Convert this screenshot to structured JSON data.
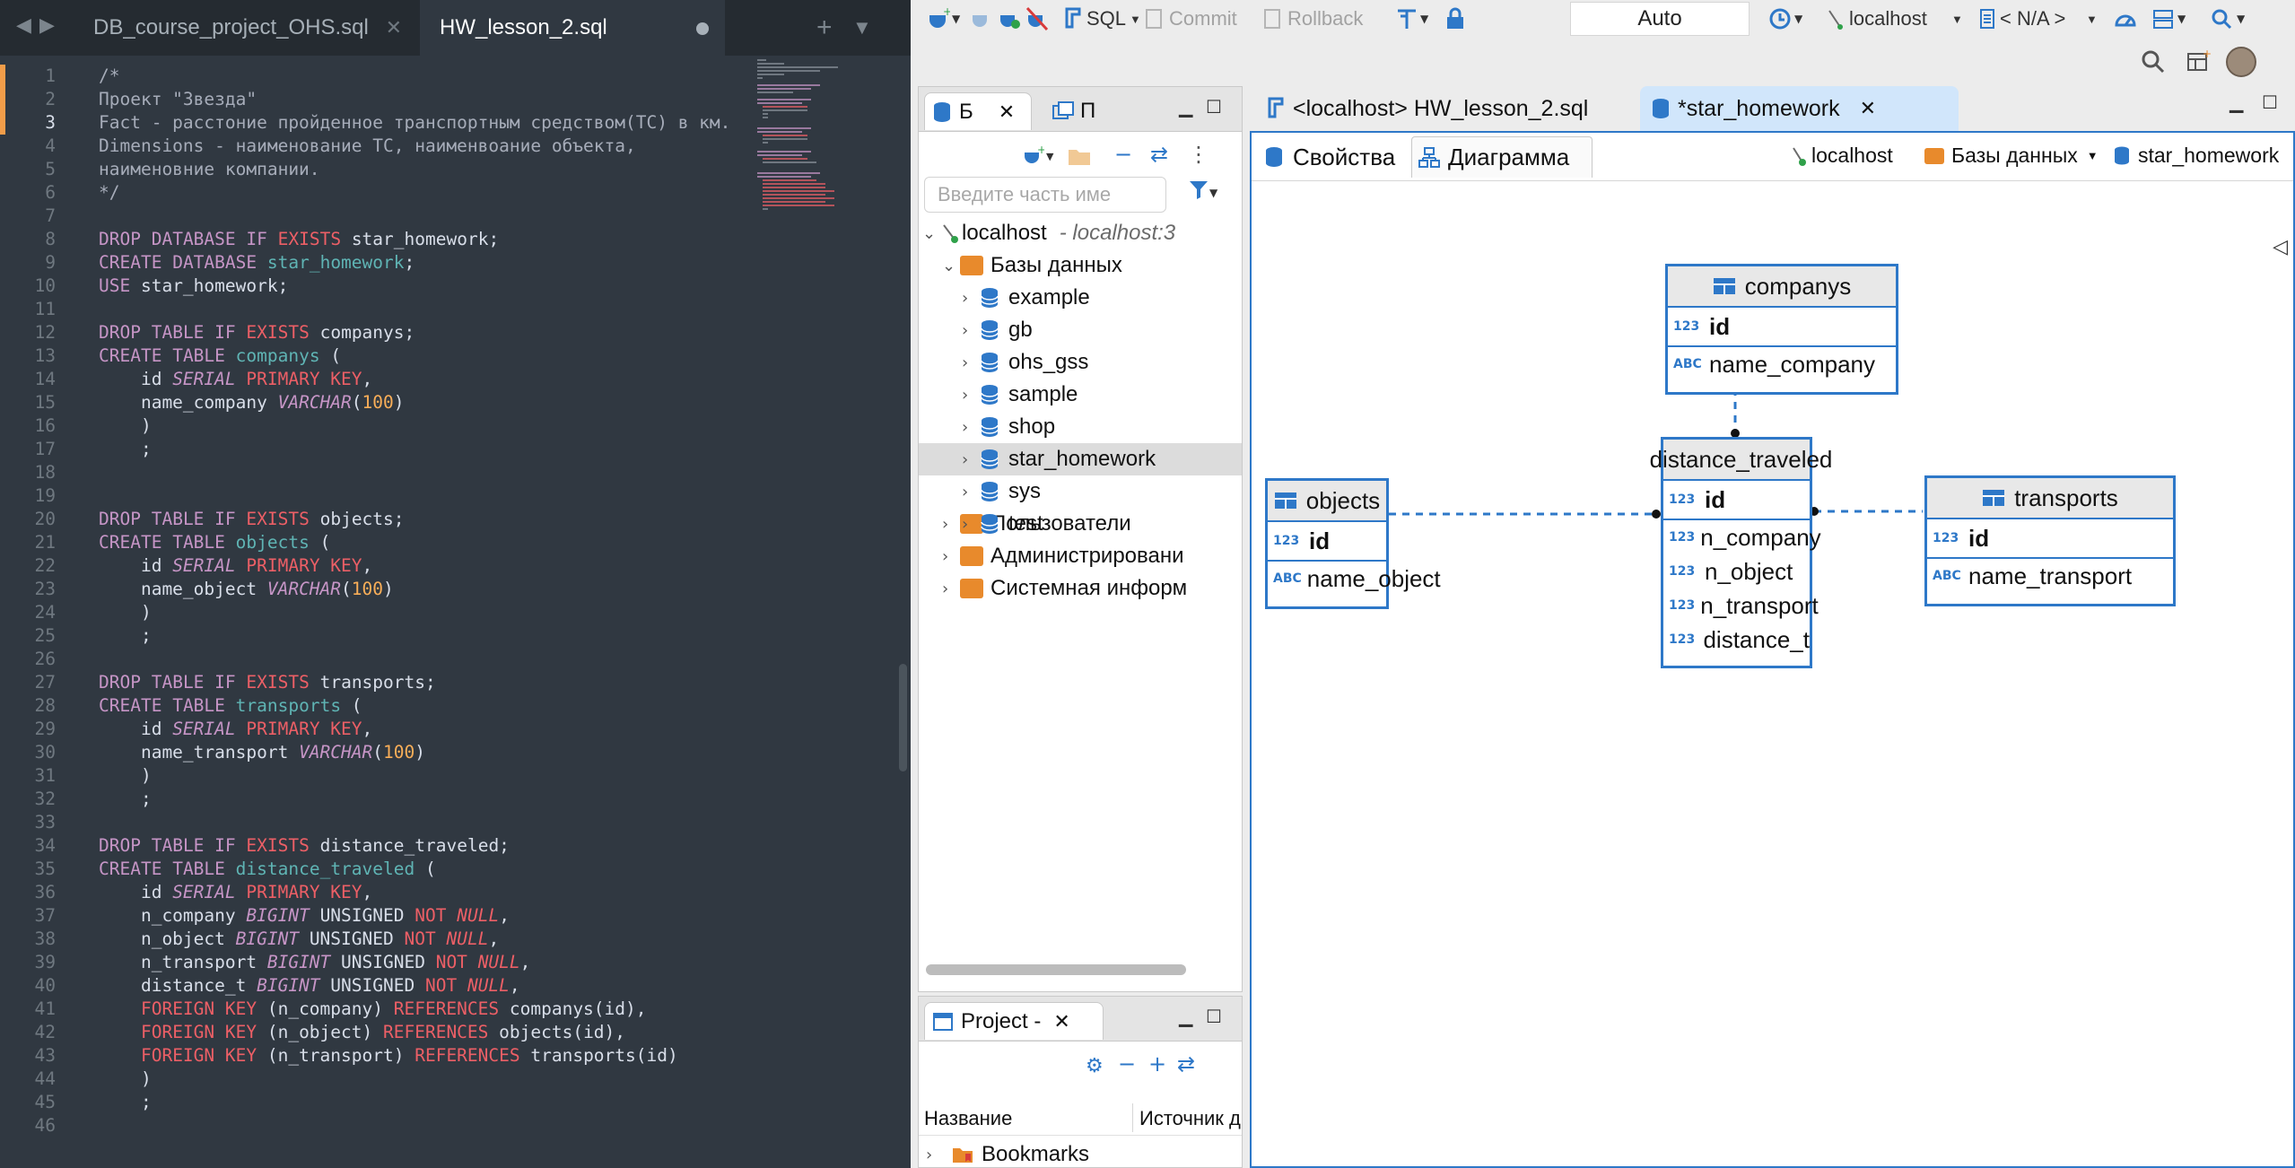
{
  "editor": {
    "tabs": [
      {
        "label": "DB_course_project_OHS.sql"
      },
      {
        "label": "HW_lesson_2.sql"
      }
    ],
    "lines": [
      [
        [
          "c",
          "/*"
        ]
      ],
      [
        [
          "c",
          "Проект \"Звезда\""
        ]
      ],
      [
        [
          "c",
          "Fact - расстоние пройденное транспортным средством(ТС) в км."
        ]
      ],
      [
        [
          "c",
          "Dimensions - наименование ТС, наименвоание объекта,"
        ]
      ],
      [
        [
          "c",
          "наименовние компании."
        ]
      ],
      [
        [
          "c",
          "*/"
        ]
      ],
      [],
      [
        [
          "k",
          "DROP"
        ],
        [
          "p",
          " "
        ],
        [
          "k",
          "DATABASE"
        ],
        [
          "p",
          " "
        ],
        [
          "k",
          "IF"
        ],
        [
          "p",
          " "
        ],
        [
          "r",
          "EXISTS"
        ],
        [
          "p",
          " star_homework;"
        ]
      ],
      [
        [
          "k",
          "CREATE"
        ],
        [
          "p",
          " "
        ],
        [
          "k",
          "DATABASE"
        ],
        [
          "p",
          " "
        ],
        [
          "i",
          "star_homework"
        ],
        [
          "p",
          ";"
        ]
      ],
      [
        [
          "k",
          "USE"
        ],
        [
          "p",
          " star_homework;"
        ]
      ],
      [],
      [
        [
          "k",
          "DROP"
        ],
        [
          "p",
          " "
        ],
        [
          "k",
          "TABLE"
        ],
        [
          "p",
          " "
        ],
        [
          "k",
          "IF"
        ],
        [
          "p",
          " "
        ],
        [
          "r",
          "EXISTS"
        ],
        [
          "p",
          " companys;"
        ]
      ],
      [
        [
          "k",
          "CREATE"
        ],
        [
          "p",
          " "
        ],
        [
          "k",
          "TABLE"
        ],
        [
          "p",
          " "
        ],
        [
          "i",
          "companys"
        ],
        [
          "p",
          " ("
        ]
      ],
      [
        [
          "p",
          "    id "
        ],
        [
          "t",
          "SERIAL"
        ],
        [
          "p",
          " "
        ],
        [
          "r",
          "PRIMARY KEY"
        ],
        [
          "p",
          ","
        ]
      ],
      [
        [
          "p",
          "    name_company "
        ],
        [
          "t",
          "VARCHAR"
        ],
        [
          "p",
          "("
        ],
        [
          "n",
          "100"
        ],
        [
          "p",
          ")"
        ]
      ],
      [
        [
          "p",
          "    )"
        ]
      ],
      [
        [
          "p",
          "    ;"
        ]
      ],
      [],
      [],
      [
        [
          "k",
          "DROP"
        ],
        [
          "p",
          " "
        ],
        [
          "k",
          "TABLE"
        ],
        [
          "p",
          " "
        ],
        [
          "k",
          "IF"
        ],
        [
          "p",
          " "
        ],
        [
          "r",
          "EXISTS"
        ],
        [
          "p",
          " objects;"
        ]
      ],
      [
        [
          "k",
          "CREATE"
        ],
        [
          "p",
          " "
        ],
        [
          "k",
          "TABLE"
        ],
        [
          "p",
          " "
        ],
        [
          "i",
          "objects"
        ],
        [
          "p",
          " ("
        ]
      ],
      [
        [
          "p",
          "    id "
        ],
        [
          "t",
          "SERIAL"
        ],
        [
          "p",
          " "
        ],
        [
          "r",
          "PRIMARY KEY"
        ],
        [
          "p",
          ","
        ]
      ],
      [
        [
          "p",
          "    name_object "
        ],
        [
          "t",
          "VARCHAR"
        ],
        [
          "p",
          "("
        ],
        [
          "n",
          "100"
        ],
        [
          "p",
          ")"
        ]
      ],
      [
        [
          "p",
          "    )"
        ]
      ],
      [
        [
          "p",
          "    ;"
        ]
      ],
      [],
      [
        [
          "k",
          "DROP"
        ],
        [
          "p",
          " "
        ],
        [
          "k",
          "TABLE"
        ],
        [
          "p",
          " "
        ],
        [
          "k",
          "IF"
        ],
        [
          "p",
          " "
        ],
        [
          "r",
          "EXISTS"
        ],
        [
          "p",
          " transports;"
        ]
      ],
      [
        [
          "k",
          "CREATE"
        ],
        [
          "p",
          " "
        ],
        [
          "k",
          "TABLE"
        ],
        [
          "p",
          " "
        ],
        [
          "i",
          "transports"
        ],
        [
          "p",
          " ("
        ]
      ],
      [
        [
          "p",
          "    id "
        ],
        [
          "t",
          "SERIAL"
        ],
        [
          "p",
          " "
        ],
        [
          "r",
          "PRIMARY KEY"
        ],
        [
          "p",
          ","
        ]
      ],
      [
        [
          "p",
          "    name_transport "
        ],
        [
          "t",
          "VARCHAR"
        ],
        [
          "p",
          "("
        ],
        [
          "n",
          "100"
        ],
        [
          "p",
          ")"
        ]
      ],
      [
        [
          "p",
          "    )"
        ]
      ],
      [
        [
          "p",
          "    ;"
        ]
      ],
      [],
      [
        [
          "k",
          "DROP"
        ],
        [
          "p",
          " "
        ],
        [
          "k",
          "TABLE"
        ],
        [
          "p",
          " "
        ],
        [
          "k",
          "IF"
        ],
        [
          "p",
          " "
        ],
        [
          "r",
          "EXISTS"
        ],
        [
          "p",
          " distance_traveled;"
        ]
      ],
      [
        [
          "k",
          "CREATE"
        ],
        [
          "p",
          " "
        ],
        [
          "k",
          "TABLE"
        ],
        [
          "p",
          " "
        ],
        [
          "i",
          "distance_traveled"
        ],
        [
          "p",
          " ("
        ]
      ],
      [
        [
          "p",
          "    id "
        ],
        [
          "t",
          "SERIAL"
        ],
        [
          "p",
          " "
        ],
        [
          "r",
          "PRIMARY KEY"
        ],
        [
          "p",
          ","
        ]
      ],
      [
        [
          "p",
          "    n_company "
        ],
        [
          "t",
          "BIGINT"
        ],
        [
          "p",
          " UNSIGNED "
        ],
        [
          "r",
          "NOT"
        ],
        [
          "p",
          " "
        ],
        [
          "rt",
          "NULL"
        ],
        [
          "p",
          ","
        ]
      ],
      [
        [
          "p",
          "    n_object "
        ],
        [
          "t",
          "BIGINT"
        ],
        [
          "p",
          " UNSIGNED "
        ],
        [
          "r",
          "NOT"
        ],
        [
          "p",
          " "
        ],
        [
          "rt",
          "NULL"
        ],
        [
          "p",
          ","
        ]
      ],
      [
        [
          "p",
          "    n_transport "
        ],
        [
          "t",
          "BIGINT"
        ],
        [
          "p",
          " UNSIGNED "
        ],
        [
          "r",
          "NOT"
        ],
        [
          "p",
          " "
        ],
        [
          "rt",
          "NULL"
        ],
        [
          "p",
          ","
        ]
      ],
      [
        [
          "p",
          "    distance_t "
        ],
        [
          "t",
          "BIGINT"
        ],
        [
          "p",
          " UNSIGNED "
        ],
        [
          "r",
          "NOT"
        ],
        [
          "p",
          " "
        ],
        [
          "rt",
          "NULL"
        ],
        [
          "p",
          ","
        ]
      ],
      [
        [
          "p",
          "    "
        ],
        [
          "r",
          "FOREIGN KEY"
        ],
        [
          "p",
          " (n_company) "
        ],
        [
          "r",
          "REFERENCES"
        ],
        [
          "p",
          " companys(id),"
        ]
      ],
      [
        [
          "p",
          "    "
        ],
        [
          "r",
          "FOREIGN KEY"
        ],
        [
          "p",
          " (n_object) "
        ],
        [
          "r",
          "REFERENCES"
        ],
        [
          "p",
          " objects(id),"
        ]
      ],
      [
        [
          "p",
          "    "
        ],
        [
          "r",
          "FOREIGN KEY"
        ],
        [
          "p",
          " (n_transport) "
        ],
        [
          "r",
          "REFERENCES"
        ],
        [
          "p",
          " transports(id)"
        ]
      ],
      [
        [
          "p",
          "    )"
        ]
      ],
      [
        [
          "p",
          "    ;"
        ]
      ],
      []
    ]
  },
  "toolbar": {
    "sql_label": "SQL",
    "commit_label": "Commit",
    "rollback_label": "Rollback",
    "auto_label": "Auto",
    "connection_label": "localhost",
    "schema_label": "< N/A >"
  },
  "navigator": {
    "tab1_label": "Б",
    "tab2_label": "П",
    "search_placeholder": "Введите часть име",
    "tree": {
      "root_label": "localhost",
      "root_detail": "- localhost:3",
      "databases_label": "Базы данных",
      "dbs": [
        "example",
        "gb",
        "ohs_gss",
        "sample",
        "shop",
        "star_homework",
        "sys",
        "test"
      ],
      "folders": [
        "Пользователи",
        "Администрировани",
        "Системная информ"
      ]
    }
  },
  "project": {
    "tab_label": "Project -",
    "col_name": "Название",
    "col_source": "Источник д",
    "row_label": "Bookmarks"
  },
  "editor_tabs": {
    "tab1_label": "<localhost> HW_lesson_2.sql",
    "tab2_label": "*star_homework"
  },
  "subtabs": {
    "props_label": "Свойства",
    "diagram_label": "Диаграмма",
    "crumb_host": "localhost",
    "crumb_dbs": "Базы данных",
    "crumb_schema": "star_homework"
  },
  "diagram": {
    "companys": {
      "title": "companys",
      "key": "id",
      "cols": [
        {
          "type": "ABC",
          "name": "name_company"
        }
      ]
    },
    "objects": {
      "title": "objects",
      "key": "id",
      "cols": [
        {
          "type": "ABC",
          "name": "name_object"
        }
      ]
    },
    "transports": {
      "title": "transports",
      "key": "id",
      "cols": [
        {
          "type": "ABC",
          "name": "name_transport"
        }
      ]
    },
    "distance": {
      "title": "distance_traveled",
      "key": "id",
      "cols": [
        {
          "type": "123",
          "name": "n_company"
        },
        {
          "type": "123",
          "name": "n_object"
        },
        {
          "type": "123",
          "name": "n_transport"
        },
        {
          "type": "123",
          "name": "distance_t"
        }
      ]
    }
  }
}
